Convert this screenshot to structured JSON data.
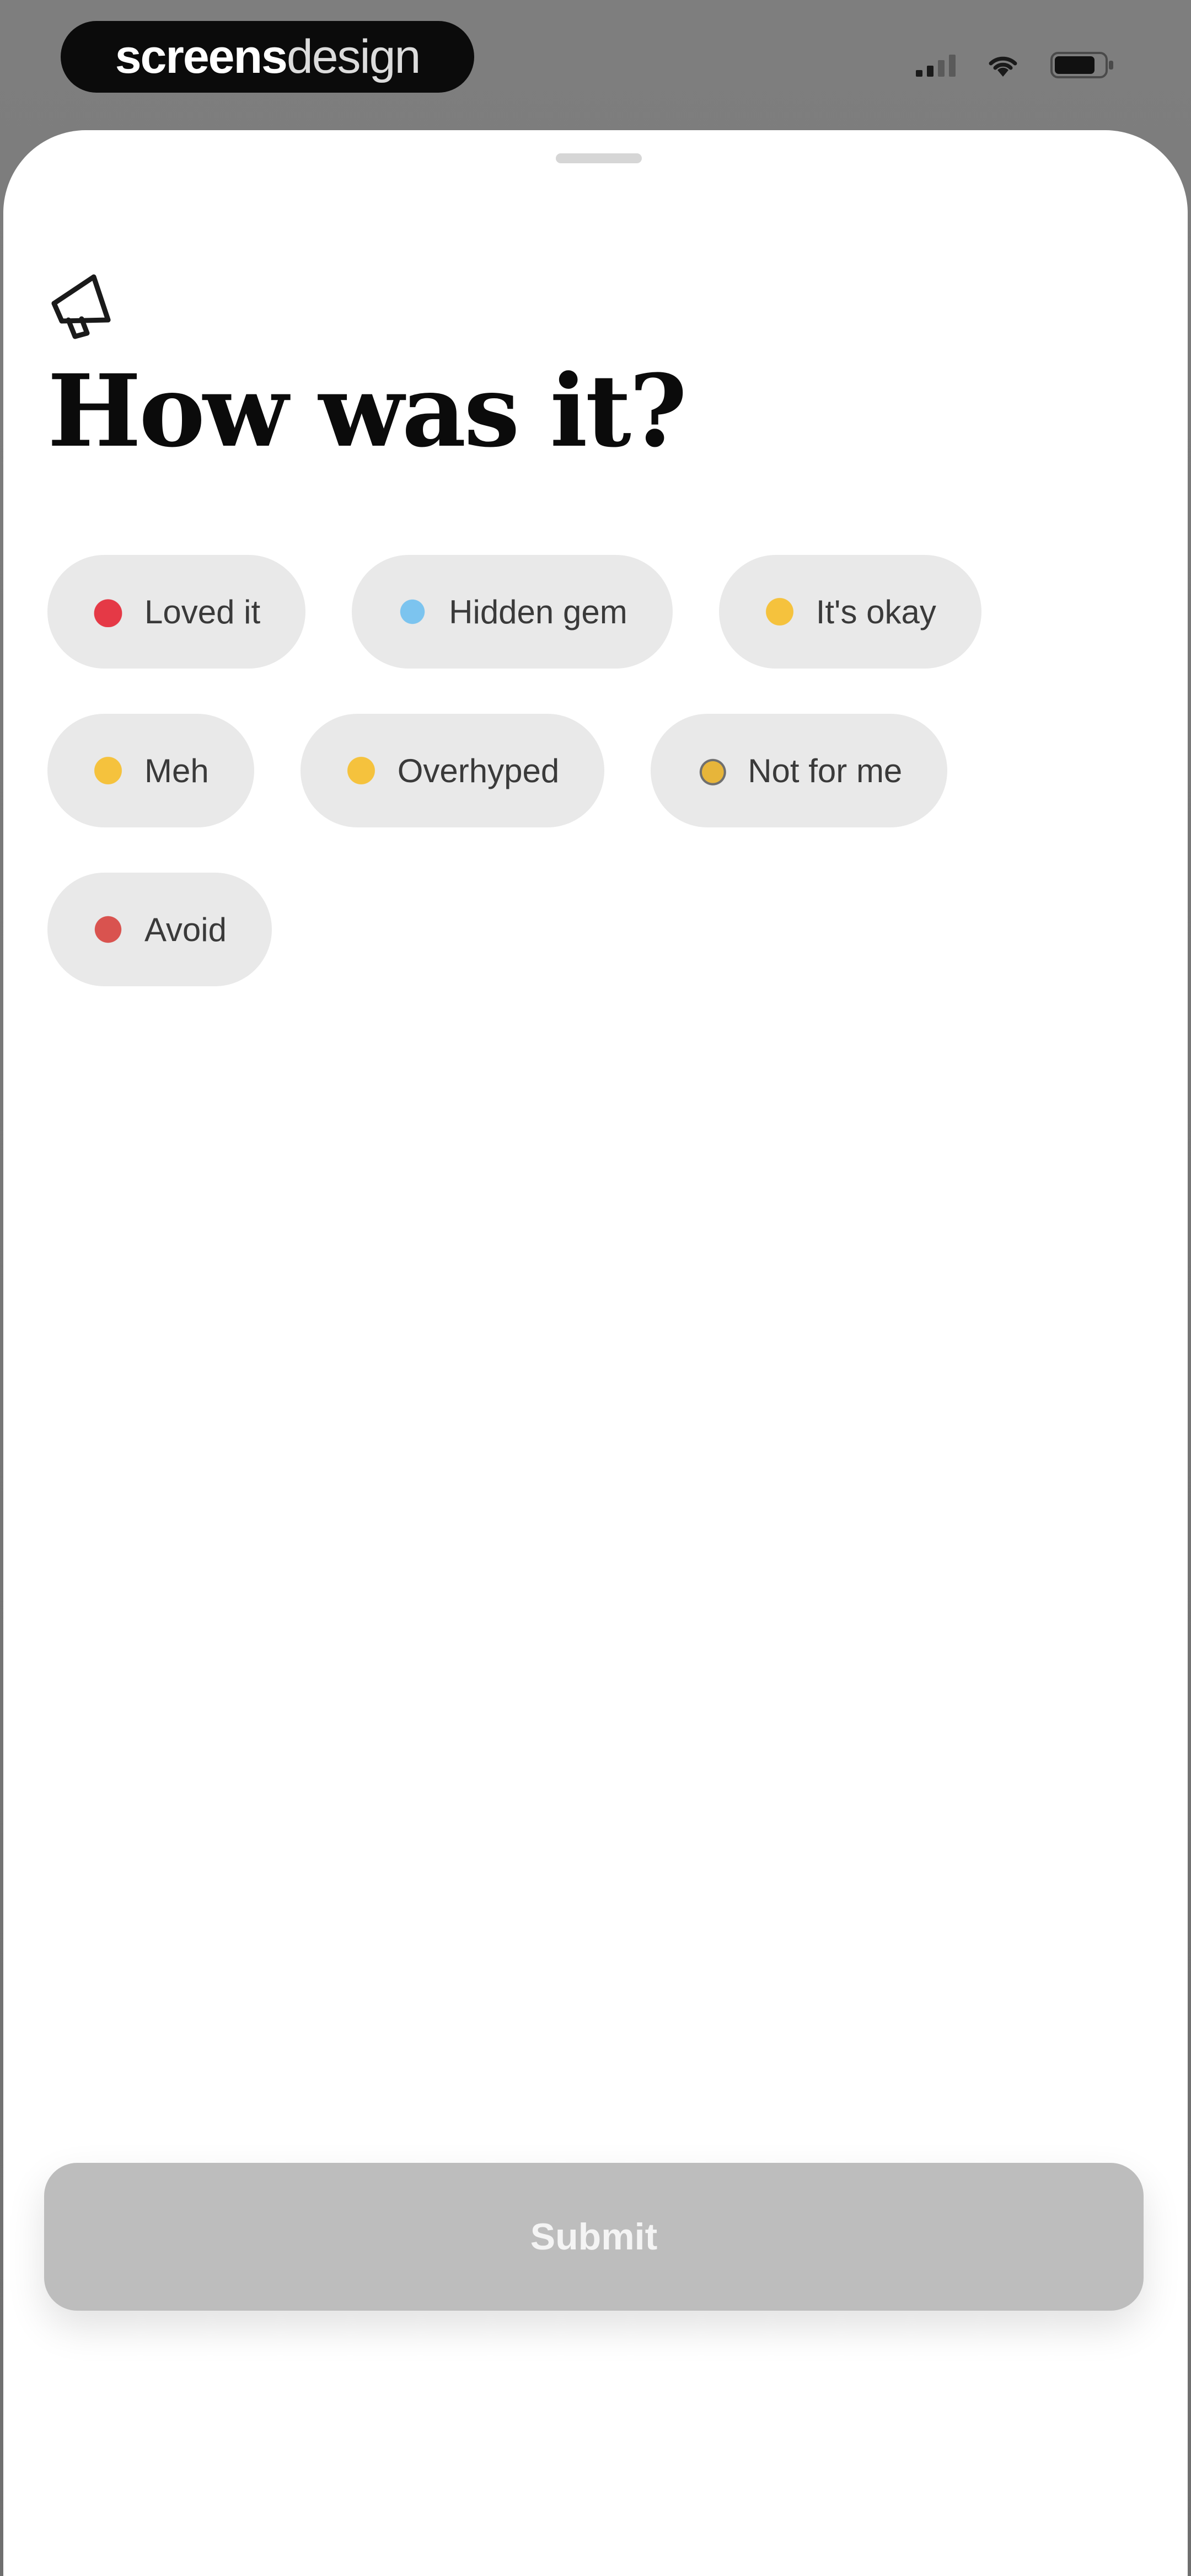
{
  "brand": {
    "bold_text": "screens",
    "light_text": "design"
  },
  "sheet": {
    "title": "How was it?",
    "title_icon": "megaphone-icon"
  },
  "reactions": [
    {
      "label": "Loved it",
      "icon": "red-heart-icon"
    },
    {
      "label": "Hidden gem",
      "icon": "gem-icon"
    },
    {
      "label": "It's okay",
      "icon": "neutral-face-icon"
    },
    {
      "label": "Meh",
      "icon": "meh-face-icon"
    },
    {
      "label": "Overhyped",
      "icon": "overhyped-face-icon"
    },
    {
      "label": "Not for me",
      "icon": "hand-icon"
    },
    {
      "label": "Avoid",
      "icon": "no-entry-icon"
    }
  ],
  "submit": {
    "label": "Submit"
  },
  "colors": {
    "chip_background": "#e9e9e9",
    "submit_disabled": "#bdbdbd",
    "title": "#0b0b0b"
  }
}
